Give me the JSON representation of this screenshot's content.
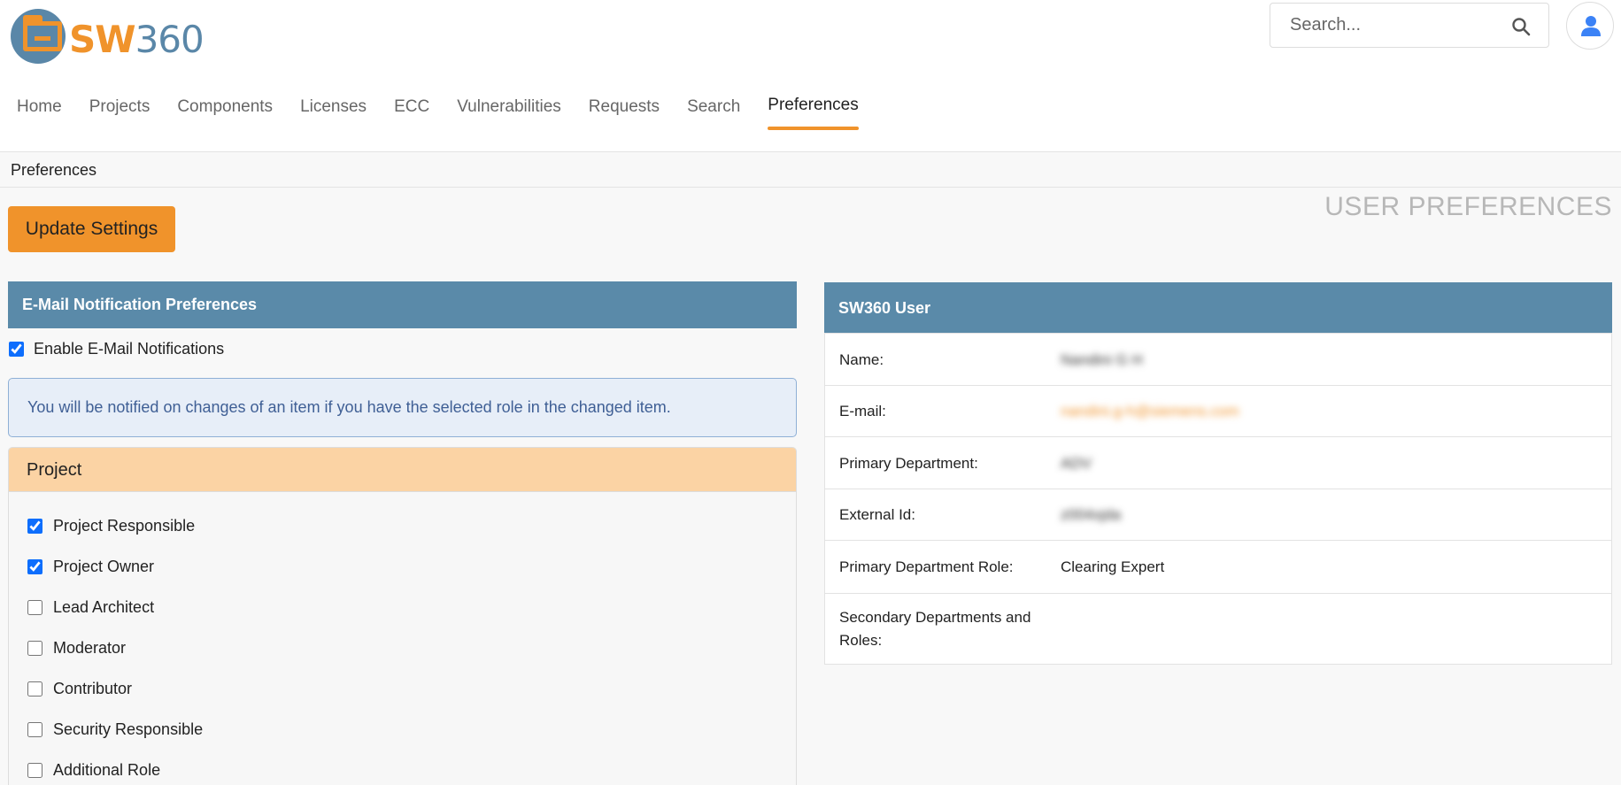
{
  "header": {
    "logo_text_sw": "SW",
    "logo_text_num": "360",
    "search": {
      "placeholder": "Search...",
      "icon": "search-icon"
    },
    "avatar_icon": "user-icon"
  },
  "nav": {
    "items": [
      "Home",
      "Projects",
      "Components",
      "Licenses",
      "ECC",
      "Vulnerabilities",
      "Requests",
      "Search",
      "Preferences"
    ],
    "active": "Preferences"
  },
  "breadcrumb": "Preferences",
  "page": {
    "heading": "USER PREFERENCES",
    "update_button": "Update Settings"
  },
  "notifications": {
    "title": "E-Mail Notification Preferences",
    "enable_label": "Enable E-Mail Notifications",
    "enabled": true,
    "info": "You will be notified on changes of an item if you have the selected role in the changed item.",
    "project": {
      "title": "Project",
      "roles": [
        {
          "label": "Project Responsible",
          "checked": true
        },
        {
          "label": "Project Owner",
          "checked": true
        },
        {
          "label": "Lead Architect",
          "checked": false
        },
        {
          "label": "Moderator",
          "checked": false
        },
        {
          "label": "Contributor",
          "checked": false
        },
        {
          "label": "Security Responsible",
          "checked": false
        },
        {
          "label": "Additional Role",
          "checked": false
        }
      ]
    }
  },
  "user": {
    "title": "SW360 User",
    "rows": [
      {
        "label": "Name:",
        "value": "Nandini G H"
      },
      {
        "label": "E-mail:",
        "value": "nandini.g-h@siemens.com"
      },
      {
        "label": "Primary Department:",
        "value": "ADV"
      },
      {
        "label": "External Id:",
        "value": "z004xjda"
      },
      {
        "label": "Primary Department Role:",
        "value": "Clearing Expert"
      },
      {
        "label": "Secondary Departments and Roles:",
        "value": ""
      }
    ]
  },
  "colors": {
    "accent": "#f0932b",
    "panel_header": "#5a8aa9",
    "project_header": "#fbd3a4",
    "info_bg": "#e7eef8"
  }
}
